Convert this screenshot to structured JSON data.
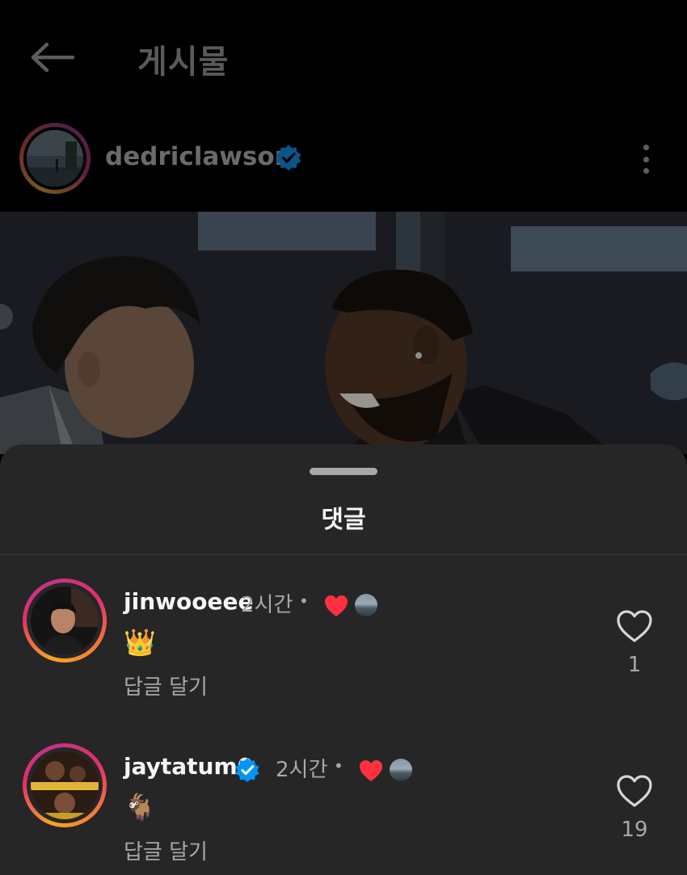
{
  "header": {
    "title": "게시물",
    "back_icon": "arrow-left-icon"
  },
  "post": {
    "author": "dedriclawson",
    "verified": true,
    "more_icon": "more-vertical-icon",
    "image_alt": "post-photo"
  },
  "comments_sheet": {
    "title": "댓글",
    "comments": [
      {
        "username": "jinwooeee",
        "verified": false,
        "time": "2시간",
        "separator": "•",
        "author_liked": true,
        "text": "👑",
        "reply_label": "답글 달기",
        "like_count": "1"
      },
      {
        "username": "jaytatum0",
        "verified": true,
        "time": "2시간",
        "separator": "•",
        "author_liked": true,
        "text": "🐐",
        "reply_label": "답글 달기",
        "like_count": "19"
      }
    ]
  },
  "colors": {
    "background": "#000000",
    "sheet": "#262626",
    "verified_blue": "#0095f6",
    "heart_red": "#ff3040",
    "muted_text": "#a8a8a8"
  }
}
